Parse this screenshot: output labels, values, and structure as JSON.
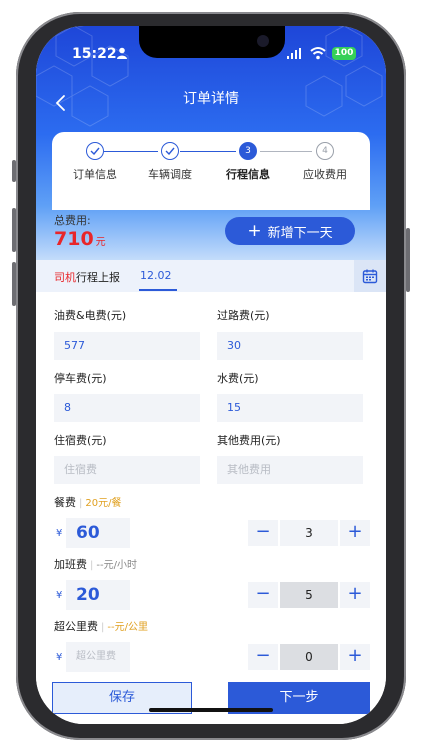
{
  "status_bar": {
    "time": "15:22",
    "battery": "100"
  },
  "header": {
    "title": "订单详情"
  },
  "steps": [
    {
      "label": "订单信息",
      "state": "done"
    },
    {
      "label": "车辆调度",
      "state": "done"
    },
    {
      "label": "行程信息",
      "state": "active",
      "number": "3"
    },
    {
      "label": "应收费用",
      "state": "todo",
      "number": "4"
    }
  ],
  "total": {
    "label": "总费用:",
    "value": "710",
    "unit": "元"
  },
  "add_day_button": "新增下一天",
  "tabs": {
    "driver_highlight": "司机",
    "driver_rest": "行程上报",
    "date": "12.02"
  },
  "fields": {
    "fuel": {
      "label": "油费&电费(元)",
      "value": "577"
    },
    "toll": {
      "label": "过路费(元)",
      "value": "30"
    },
    "parking": {
      "label": "停车费(元)",
      "value": "8"
    },
    "water": {
      "label": "水费(元)",
      "value": "15"
    },
    "lodging": {
      "label": "住宿费(元)",
      "placeholder": "住宿费"
    },
    "other": {
      "label": "其他费用(元)",
      "placeholder": "其他费用"
    }
  },
  "meal": {
    "label": "餐费",
    "rate": "20元/餐",
    "currency": "¥",
    "price": "60",
    "qty": "3"
  },
  "overtime": {
    "label": "加班费",
    "rate": "--元/小时",
    "currency": "¥",
    "price": "20",
    "qty": "5"
  },
  "mileage": {
    "label": "超公里费",
    "rate": "--元/公里",
    "currency": "¥",
    "placeholder": "超公里费",
    "qty": "0"
  },
  "footer": {
    "save": "保存",
    "next": "下一步"
  },
  "colors": {
    "primary": "#2c5ad8",
    "accent_red": "#e8262a",
    "rate_orange": "#e0a020"
  }
}
